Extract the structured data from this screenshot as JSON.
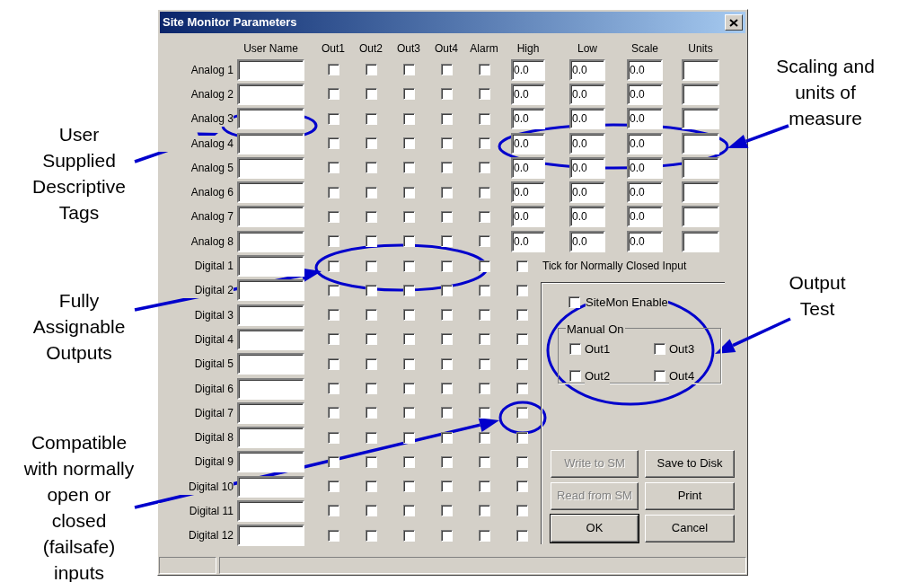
{
  "window": {
    "title": "Site Monitor Parameters"
  },
  "columns": [
    "User Name",
    "Out1",
    "Out2",
    "Out3",
    "Out4",
    "Alarm",
    "High",
    "Low",
    "Scale",
    "Units"
  ],
  "analog_rows": [
    {
      "label": "Analog 1",
      "outputs": [
        {
          "checked": false
        },
        {
          "checked": false
        },
        {
          "checked": false
        },
        {
          "checked": false
        },
        {
          "checked": false
        }
      ],
      "high": "0.0",
      "low": "0.0",
      "scale": "0.0"
    },
    {
      "label": "Analog 2",
      "outputs": [
        {
          "checked": false
        },
        {
          "checked": false
        },
        {
          "checked": false
        },
        {
          "checked": false
        },
        {
          "checked": false
        }
      ],
      "high": "0.0",
      "low": "0.0",
      "scale": "0.0"
    },
    {
      "label": "Analog 3",
      "outputs": [
        {
          "checked": false
        },
        {
          "checked": false
        },
        {
          "checked": false
        },
        {
          "checked": false
        },
        {
          "checked": false
        }
      ],
      "high": "0.0",
      "low": "0.0",
      "scale": "0.0"
    },
    {
      "label": "Analog 4",
      "outputs": [
        {
          "checked": false
        },
        {
          "checked": false
        },
        {
          "checked": false
        },
        {
          "checked": false
        },
        {
          "checked": false
        }
      ],
      "high": "0.0",
      "low": "0.0",
      "scale": "0.0"
    },
    {
      "label": "Analog 5",
      "outputs": [
        {
          "checked": false
        },
        {
          "checked": false
        },
        {
          "checked": false
        },
        {
          "checked": false
        },
        {
          "checked": false
        }
      ],
      "high": "0.0",
      "low": "0.0",
      "scale": "0.0"
    },
    {
      "label": "Analog 6",
      "outputs": [
        {
          "checked": false
        },
        {
          "checked": false
        },
        {
          "checked": false
        },
        {
          "checked": false
        },
        {
          "checked": false
        }
      ],
      "high": "0.0",
      "low": "0.0",
      "scale": "0.0"
    },
    {
      "label": "Analog 7",
      "outputs": [
        {
          "checked": false
        },
        {
          "checked": false
        },
        {
          "checked": false
        },
        {
          "checked": false
        },
        {
          "checked": false
        }
      ],
      "high": "0.0",
      "low": "0.0",
      "scale": "0.0"
    },
    {
      "label": "Analog 8",
      "outputs": [
        {
          "checked": false
        },
        {
          "checked": false
        },
        {
          "checked": false
        },
        {
          "checked": false
        },
        {
          "checked": false
        }
      ],
      "high": "0.0",
      "low": "0.0",
      "scale": "0.0"
    }
  ],
  "digital_rows": [
    {
      "label": "Digital 1",
      "outputs": [
        {
          "checked": false
        },
        {
          "checked": false
        },
        {
          "checked": false
        },
        {
          "checked": false
        },
        {
          "checked": false
        }
      ],
      "normally_closed": false,
      "note": "Tick for Normally Closed Input"
    },
    {
      "label": "Digital 2",
      "outputs": [
        {
          "checked": false
        },
        {
          "checked": false
        },
        {
          "checked": false
        },
        {
          "checked": false
        },
        {
          "checked": false
        }
      ],
      "normally_closed": false
    },
    {
      "label": "Digital 3",
      "outputs": [
        {
          "checked": false
        },
        {
          "checked": false
        },
        {
          "checked": false
        },
        {
          "checked": false
        },
        {
          "checked": false
        }
      ],
      "normally_closed": false
    },
    {
      "label": "Digital 4",
      "outputs": [
        {
          "checked": false
        },
        {
          "checked": false
        },
        {
          "checked": false
        },
        {
          "checked": false
        },
        {
          "checked": false
        }
      ],
      "normally_closed": false
    },
    {
      "label": "Digital 5",
      "outputs": [
        {
          "checked": false
        },
        {
          "checked": false
        },
        {
          "checked": false
        },
        {
          "checked": false
        },
        {
          "checked": false
        }
      ],
      "normally_closed": false
    },
    {
      "label": "Digital 6",
      "outputs": [
        {
          "checked": false
        },
        {
          "checked": false
        },
        {
          "checked": false
        },
        {
          "checked": false
        },
        {
          "checked": false
        }
      ],
      "normally_closed": false
    },
    {
      "label": "Digital 7",
      "outputs": [
        {
          "checked": false
        },
        {
          "checked": false
        },
        {
          "checked": false
        },
        {
          "checked": false
        },
        {
          "checked": false
        }
      ],
      "normally_closed": false
    },
    {
      "label": "Digital 8",
      "outputs": [
        {
          "checked": false
        },
        {
          "checked": false
        },
        {
          "checked": false
        },
        {
          "checked": false
        },
        {
          "checked": false
        }
      ],
      "normally_closed": false
    },
    {
      "label": "Digital 9",
      "outputs": [
        {
          "checked": false
        },
        {
          "checked": false
        },
        {
          "checked": false
        },
        {
          "checked": false
        },
        {
          "checked": false
        }
      ],
      "normally_closed": false
    },
    {
      "label": "Digital 10",
      "outputs": [
        {
          "checked": false
        },
        {
          "checked": false
        },
        {
          "checked": false
        },
        {
          "checked": false
        },
        {
          "checked": false
        }
      ],
      "normally_closed": false
    },
    {
      "label": "Digital 11",
      "outputs": [
        {
          "checked": false
        },
        {
          "checked": false
        },
        {
          "checked": false
        },
        {
          "checked": false
        },
        {
          "checked": false
        }
      ],
      "normally_closed": false
    },
    {
      "label": "Digital 12",
      "outputs": [
        {
          "checked": false
        },
        {
          "checked": false
        },
        {
          "checked": false
        },
        {
          "checked": false
        },
        {
          "checked": false
        }
      ],
      "normally_closed": false
    }
  ],
  "sitemon_enable": {
    "label": "SiteMon Enable",
    "checked": false
  },
  "manual_on": {
    "title": "Manual On",
    "outputs": [
      {
        "label": "Out1",
        "checked": false
      },
      {
        "label": "Out3",
        "checked": false
      },
      {
        "label": "Out2",
        "checked": false
      },
      {
        "label": "Out4",
        "checked": false
      }
    ]
  },
  "buttons": [
    {
      "label": "Write to SM",
      "disabled": true,
      "default": false
    },
    {
      "label": "Save to Disk",
      "disabled": false,
      "default": false
    },
    {
      "label": "Read from SM",
      "disabled": true,
      "default": false
    },
    {
      "label": "Print",
      "disabled": false,
      "default": false
    },
    {
      "label": "OK",
      "disabled": false,
      "default": true
    },
    {
      "label": "Cancel",
      "disabled": false,
      "default": false
    }
  ],
  "annotations": [
    {
      "text": "User\nSupplied\nDescriptive\nTags"
    },
    {
      "text": "Fully\nAssignable\nOutputs"
    },
    {
      "text": "Compatible\nwith normally\nopen or\nclosed\n(failsafe)\ninputs"
    },
    {
      "text": "Scaling and\nunits of\nmeasure"
    },
    {
      "text": "Output\nTest"
    }
  ]
}
